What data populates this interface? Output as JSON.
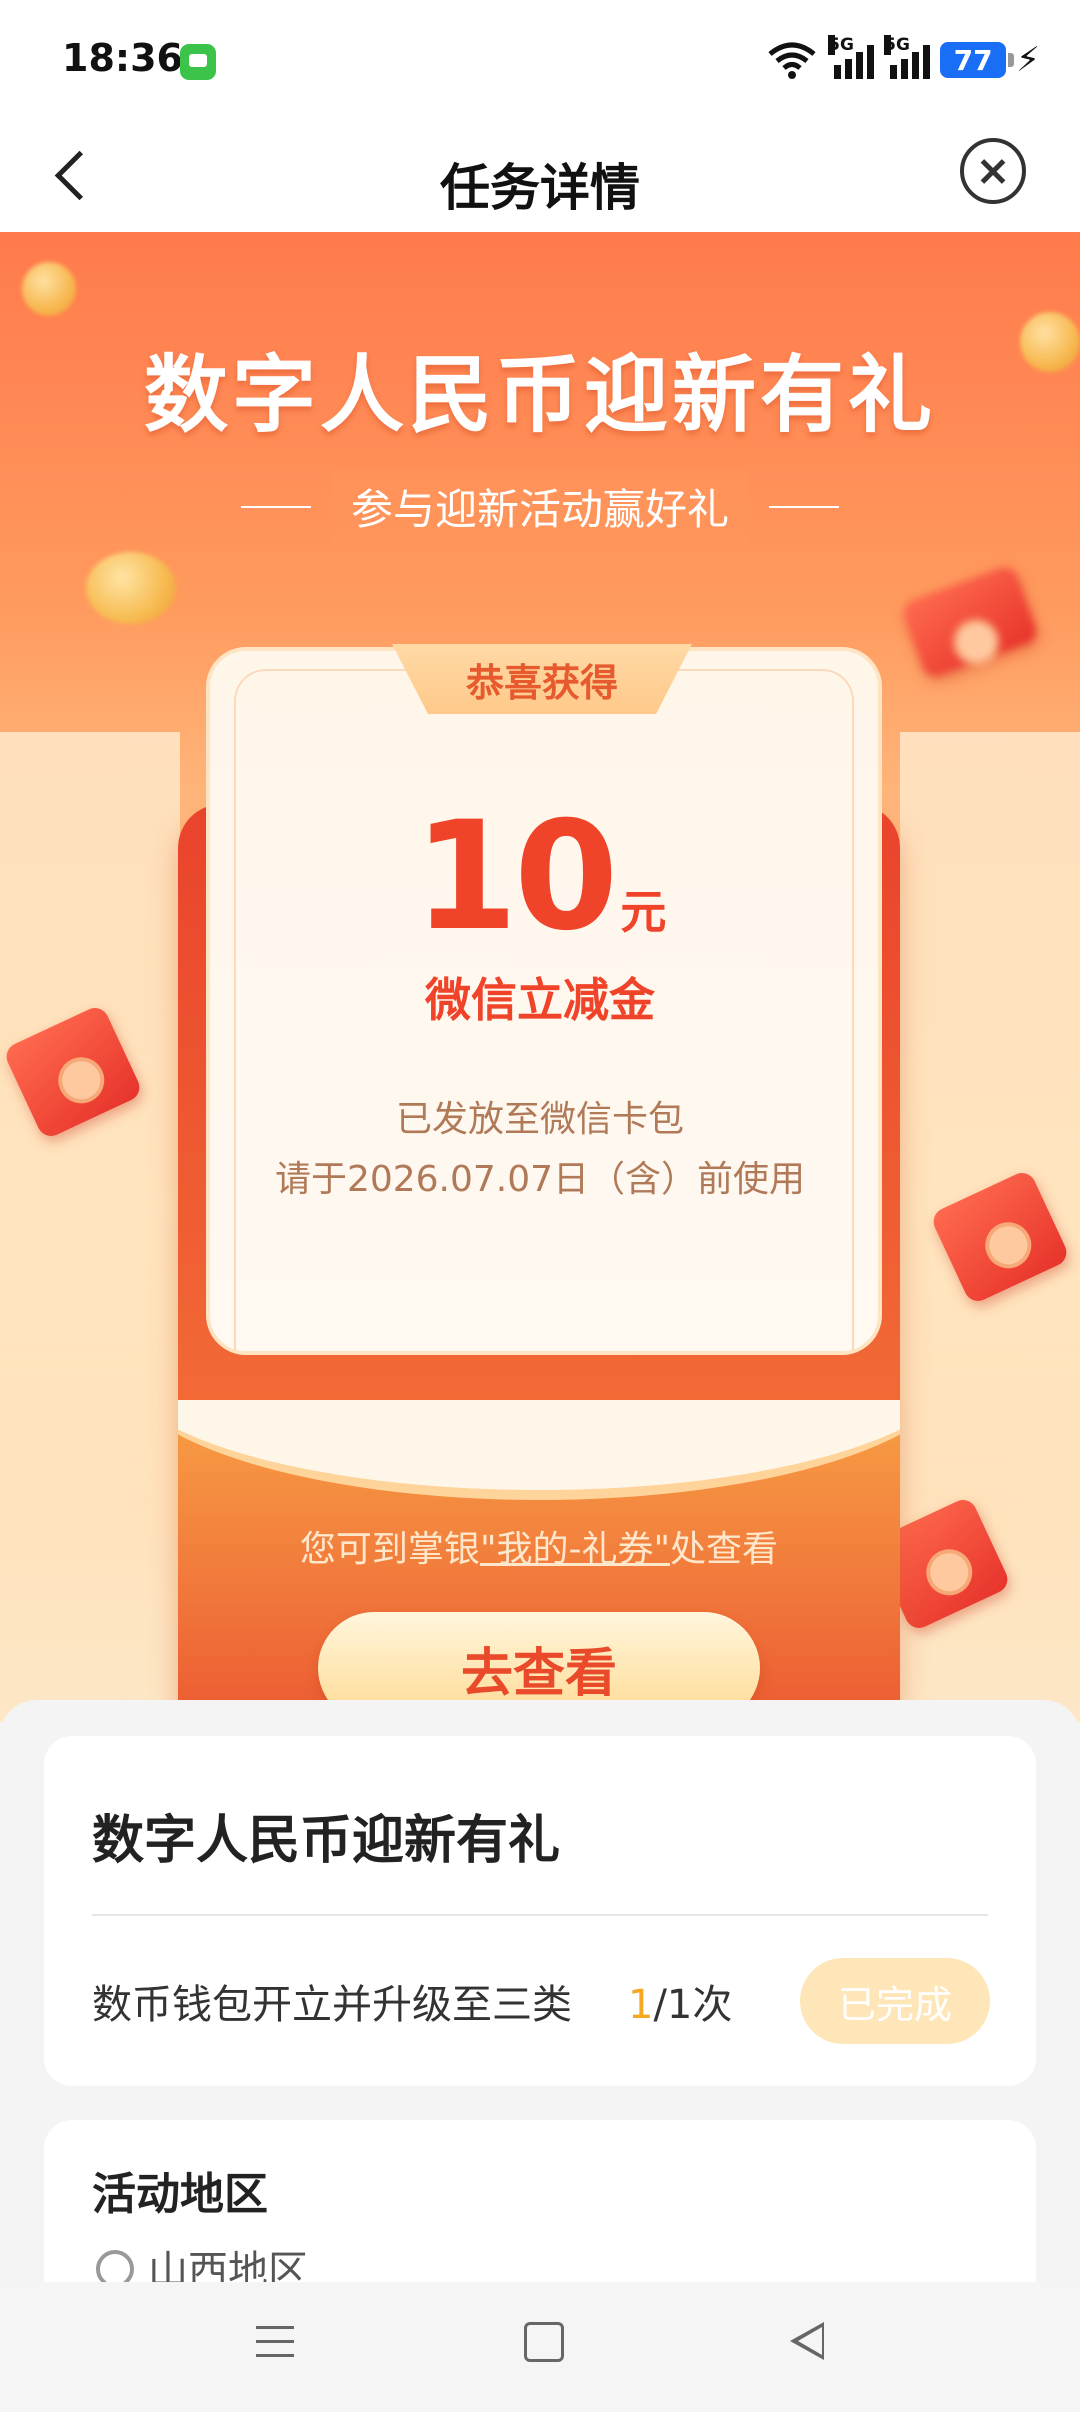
{
  "status_bar": {
    "time": "18:36",
    "network_1": "5G",
    "network_2": "5G",
    "battery": "77",
    "charging_icon": "bolt-icon",
    "message_app_icon": "message-app-icon"
  },
  "header": {
    "title": "任务详情",
    "back_icon": "chevron-left-icon",
    "close_icon": "close-circle-icon"
  },
  "banner": {
    "title": "数字人民币迎新有礼",
    "subtitle": "参与迎新活动赢好礼",
    "congrats_label": "恭喜获得",
    "amount": "10",
    "amount_unit": "元",
    "gift_name": "微信立减金",
    "note_line1": "已发放至微信卡包",
    "note_line2": "请于2026.07.07日（含）前使用",
    "hint_prefix": "您可到掌银",
    "hint_link": "\"我的-礼券\"",
    "hint_suffix": "处查看",
    "view_button": "去查看"
  },
  "task": {
    "title": "数字人民币迎新有礼",
    "item_text": "数币钱包开立并升级至三类",
    "progress_current": "1",
    "progress_rest": "/1次",
    "status_button": "已完成"
  },
  "region": {
    "title": "活动地区",
    "value": "山西地区",
    "icon": "location-pin-icon"
  },
  "colors": {
    "accent_red": "#f0442a",
    "banner_top": "#ff7a4c",
    "done_button_bg": "#ffe6b8",
    "progress_highlight": "#f5a623"
  }
}
